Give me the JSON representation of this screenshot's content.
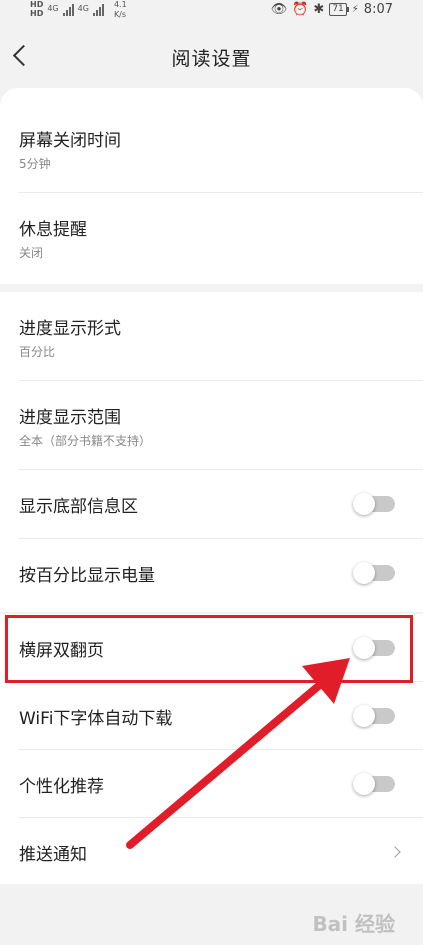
{
  "status_bar": {
    "sim1": "HD",
    "sim2": "HD",
    "net1": "4G",
    "net2": "4G",
    "speed_value": "4.1",
    "speed_unit": "K/s",
    "battery": "71",
    "time": "8:07"
  },
  "header": {
    "title": "阅读设置"
  },
  "group1": [
    {
      "title": "屏幕关闭时间",
      "subtitle": "5分钟"
    },
    {
      "title": "休息提醒",
      "subtitle": "关闭"
    }
  ],
  "group2": [
    {
      "title": "进度显示形式",
      "subtitle": "百分比"
    },
    {
      "title": "进度显示范围",
      "subtitle": "全本（部分书籍不支持）"
    },
    {
      "title": "显示底部信息区",
      "toggle": false
    },
    {
      "title": "按百分比显示电量",
      "toggle": false
    }
  ],
  "group3": [
    {
      "title": "横屏双翻页",
      "toggle": false
    },
    {
      "title": "WiFi下字体自动下载",
      "toggle": false
    },
    {
      "title": "个性化推荐",
      "toggle": false
    },
    {
      "title": "推送通知"
    }
  ],
  "annotation": {
    "highlight_color": "#e11d2a"
  },
  "watermark": "Bai 经验"
}
